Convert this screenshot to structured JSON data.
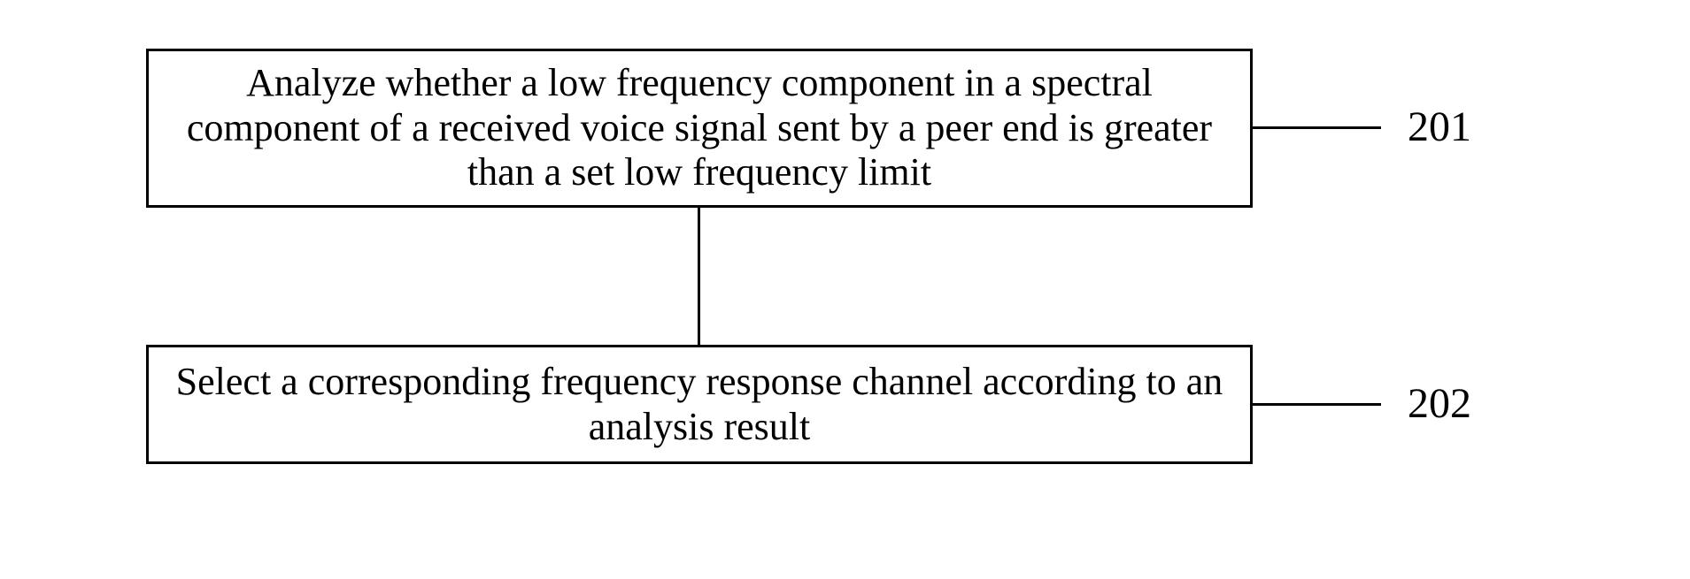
{
  "diagram": {
    "step1": {
      "text": "Analyze whether a low frequency component in a spectral component of a received voice signal sent by a peer end is greater than a set low frequency limit",
      "ref": "201"
    },
    "step2": {
      "text": "Select a corresponding frequency response channel according to an analysis result",
      "ref": "202"
    }
  }
}
